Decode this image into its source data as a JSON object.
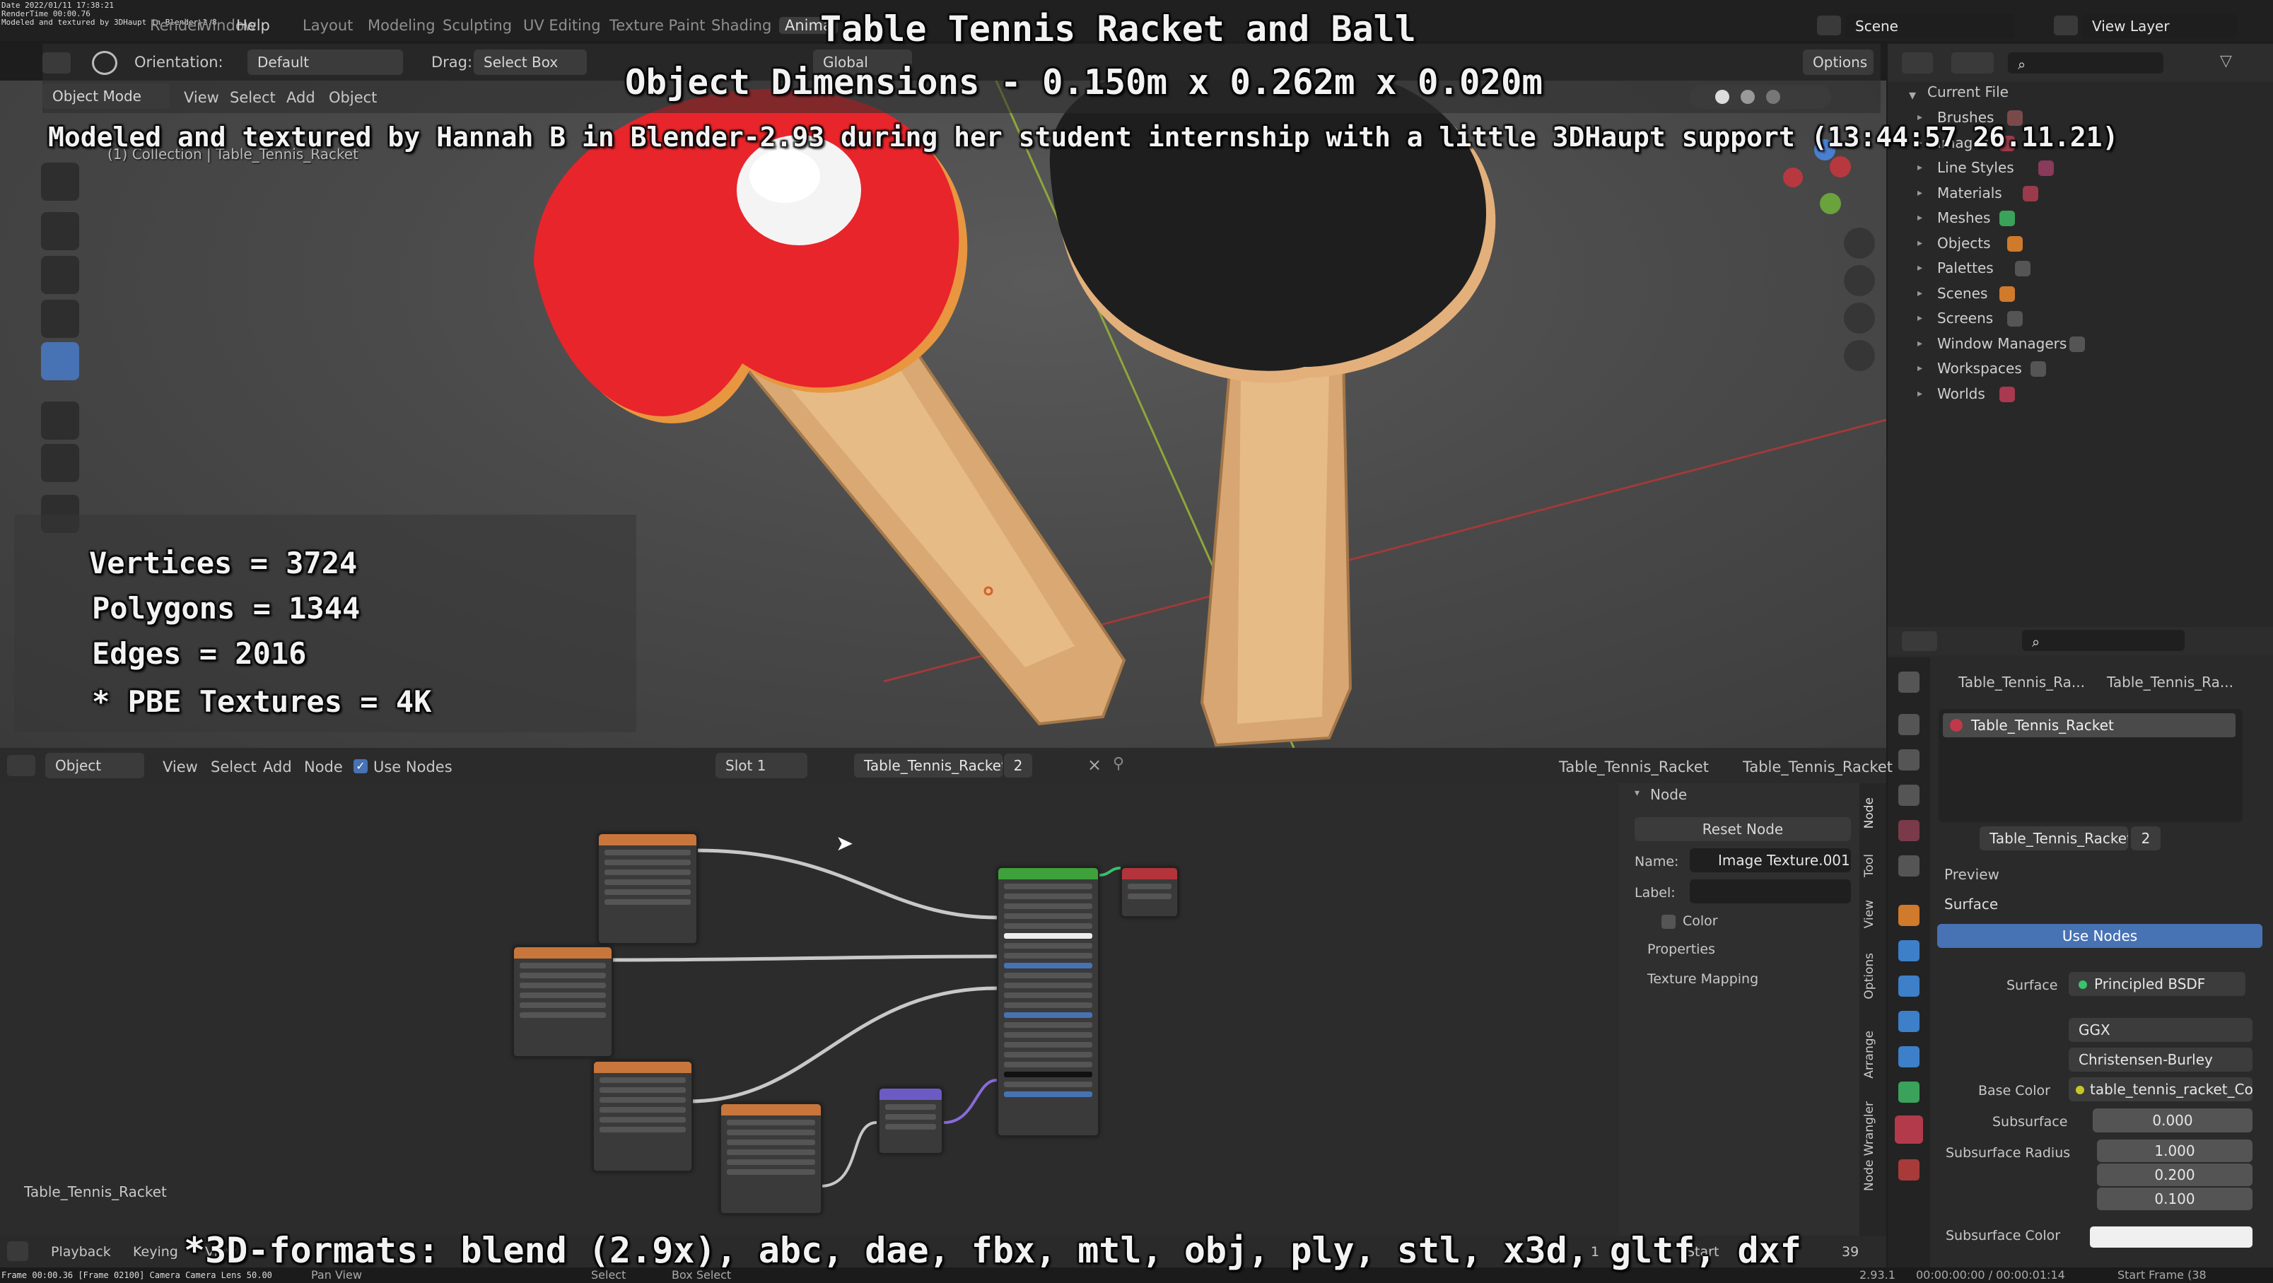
{
  "overlay": {
    "title": "Table Tennis Racket and Ball",
    "dimensions": "Object Dimensions -  0.150m x 0.262m x 0.020m",
    "credit": "Modeled and textured by Hannah B in Blender-2.93 during her student internship with a little 3DHaupt support (13:44:57 26.11.21)",
    "stats": [
      "Vertices = 3724",
      "Polygons = 1344",
      "Edges = 2016",
      "* PBE Textures = 4K"
    ],
    "formats": "*3D-formats: blend (2.9x), abc, dae, fbx, mtl, obj, ply, stl, x3d, gltf, dxf",
    "corner_info": [
      "Date 2022/01/11 17:38:21",
      "RenderTime 00:00.76",
      "Modeled and textured by 3DHaupt in Blender-2.8"
    ]
  },
  "topbar": {
    "menus": [
      "Render",
      "Window",
      "Help"
    ],
    "workspaces": [
      "Layout",
      "Modeling",
      "Sculpting",
      "UV Editing",
      "Texture Paint",
      "Shading",
      "Anima"
    ],
    "scene_label": "Scene",
    "view_layer_label": "View Layer"
  },
  "viewport_header": {
    "orientation_label": "Orientation:",
    "orientation_value": "Default",
    "drag_label": "Drag:",
    "drag_value": "Select Box",
    "transform_space": "Global",
    "options_label": "Options",
    "mode": "Object Mode",
    "menus": [
      "View",
      "Select",
      "Add",
      "Object"
    ],
    "collection_path": "(1) Collection | Table_Tennis_Racket"
  },
  "outliner": {
    "root": "Current File",
    "items": [
      "Brushes",
      "Images",
      "Line Styles",
      "Materials",
      "Meshes",
      "Objects",
      "Palettes",
      "Scenes",
      "Screens",
      "Window Managers",
      "Workspaces",
      "Worlds"
    ]
  },
  "properties": {
    "breadcrumb_object": "Table_Tennis_Ra...",
    "breadcrumb_material": "Table_Tennis_Ra...",
    "material_slot": "Table_Tennis_Racket",
    "material_name": "Table_Tennis_Racket",
    "user_count": "2",
    "preview_label": "Preview",
    "surface_label": "Surface",
    "use_nodes_label": "Use Nodes",
    "surface_field_label": "Surface",
    "surface_value": "Principled BSDF",
    "distribution": "GGX",
    "subsurface_method": "Christensen-Burley",
    "base_color_label": "Base Color",
    "base_color_value": "table_tennis_racket_Col.j...",
    "subsurface_label": "Subsurface",
    "subsurface_value": "0.000",
    "subsurface_radius_label": "Subsurface Radius",
    "subsurface_radius": [
      "1.000",
      "0.200",
      "0.100"
    ],
    "subsurface_color_label": "Subsurface Color"
  },
  "node_editor": {
    "editor_type": "Object",
    "menus": [
      "View",
      "Select",
      "Add",
      "Node"
    ],
    "use_nodes_label": "Use Nodes",
    "slot": "Slot 1",
    "material": "Table_Tennis_Racket",
    "user_count": "2",
    "object_crumb": "Table_Tennis_Racket",
    "material_crumb": "Table_Tennis_Racket",
    "tree_label": "Table_Tennis_Racket",
    "n_panel": {
      "section": "Node",
      "reset_label": "Reset Node",
      "name_label": "Name:",
      "name_value": "Image Texture.001",
      "label_label": "Label:",
      "color_label": "Color",
      "properties_label": "Properties",
      "texture_mapping_label": "Texture Mapping"
    },
    "side_tabs": [
      "Node",
      "Tool",
      "View",
      "Options",
      "Arrange",
      "Node Wrangler"
    ]
  },
  "timeline": {
    "playback_label": "Playback",
    "keying_label": "Keying",
    "view_label": "View",
    "start_label": "Start",
    "start_frame": "1",
    "end_frame": "39"
  },
  "status": {
    "left": "Frame 00:00.36  [Frame 02100]  Camera Camera  Lens 50.00",
    "select_label": "Select",
    "box_select_label": "Box Select",
    "pan_label": "Pan View",
    "version": "2.93.1",
    "timecode": "00:00:00:00 / 00:00:01:14",
    "start_frame_label": "Start Frame (38"
  },
  "colors": {
    "accent": "#4772b3",
    "rubber_red": "#e8252b",
    "rubber_black": "#1e1e1e",
    "wood": "#e2b47f",
    "node_texture_header": "#c8763b",
    "node_bsdf_header": "#3fa13c",
    "node_output_header": "#b3343a",
    "node_vector_header": "#6c5bc4"
  }
}
